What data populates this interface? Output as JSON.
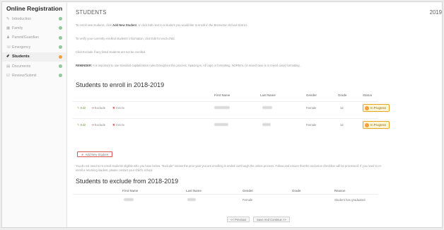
{
  "sidebar": {
    "title": "Online Registration",
    "items": [
      {
        "icon": "pencil-icon",
        "glyph": "✎",
        "label": "Introduction",
        "status": "green"
      },
      {
        "icon": "grid-icon",
        "glyph": "▦",
        "label": "Family",
        "status": "green"
      },
      {
        "icon": "person-icon",
        "glyph": "♟",
        "label": "Parent/Guardian",
        "status": "green"
      },
      {
        "icon": "phone-icon",
        "glyph": "☏",
        "label": "Emergency",
        "status": "green"
      },
      {
        "icon": "students-icon",
        "glyph": "✐",
        "label": "Students",
        "status": "orange",
        "active": true
      },
      {
        "icon": "document-icon",
        "glyph": "▤",
        "label": "Documents",
        "status": "green"
      },
      {
        "icon": "review-icon",
        "glyph": "☑",
        "label": "Review/Submit",
        "status": "green"
      }
    ]
  },
  "header": {
    "title": "STUDENTS",
    "year": "2019"
  },
  "instructions": {
    "p1_before": "To enroll new students, click ",
    "p1_bold": "Add New Student",
    "p1_after": ", or click Edit next to a student you would like to enroll in the Bremerton School District.",
    "p2": "To verify your currently enrolled students' information, click Edit for each child.",
    "p3": "Click Exclude if any listed students are not be enrolled.",
    "reminder_bold": "REMINDER:",
    "reminder_text": " It is important to use standard capitalization rules throughout this process. Spacing is, All caps or formatting. NORMAL (in mixed case is in mixed case) formatting."
  },
  "enroll": {
    "heading": "Students to enroll in 2018-2019",
    "columns": {
      "first": "First Name",
      "last": "Last Name",
      "gender": "Gender",
      "grade": "Grade",
      "status": "Status"
    },
    "actions": {
      "edit": "Edit",
      "exclude": "Exclude",
      "delete": "Delete"
    },
    "rows": [
      {
        "gender": "Female",
        "grade": "12",
        "status": "In Progress"
      },
      {
        "gender": "Female",
        "grade": "12",
        "status": "In Progress"
      }
    ],
    "add_label": "Add New Student"
  },
  "note": {
    "line1": "You do not need to re-enroll students eligible who you have below. \"Exclude\" means the prior year you are enrolling is ended out though the online process. Follow and ensure that the exclusion checkbox will be processed. If you need to re-",
    "line2": "enroll a returning student, please contact your child's school."
  },
  "exclude": {
    "heading": "Students to exclude from 2018-2019",
    "columns": {
      "first": "First Name",
      "last": "Last Name",
      "gender": "Gender",
      "grade": "Grade",
      "reason": "Reason"
    },
    "rows": [
      {
        "gender": "Female",
        "grade": "",
        "reason": "Student has graduated"
      }
    ]
  },
  "footer": {
    "prev": "<< Previous",
    "next": "Save And Continue >>"
  },
  "colors": {
    "accent_orange": "#f0a33a",
    "ok_green": "#8fc99a",
    "danger_red": "#d9534f"
  }
}
